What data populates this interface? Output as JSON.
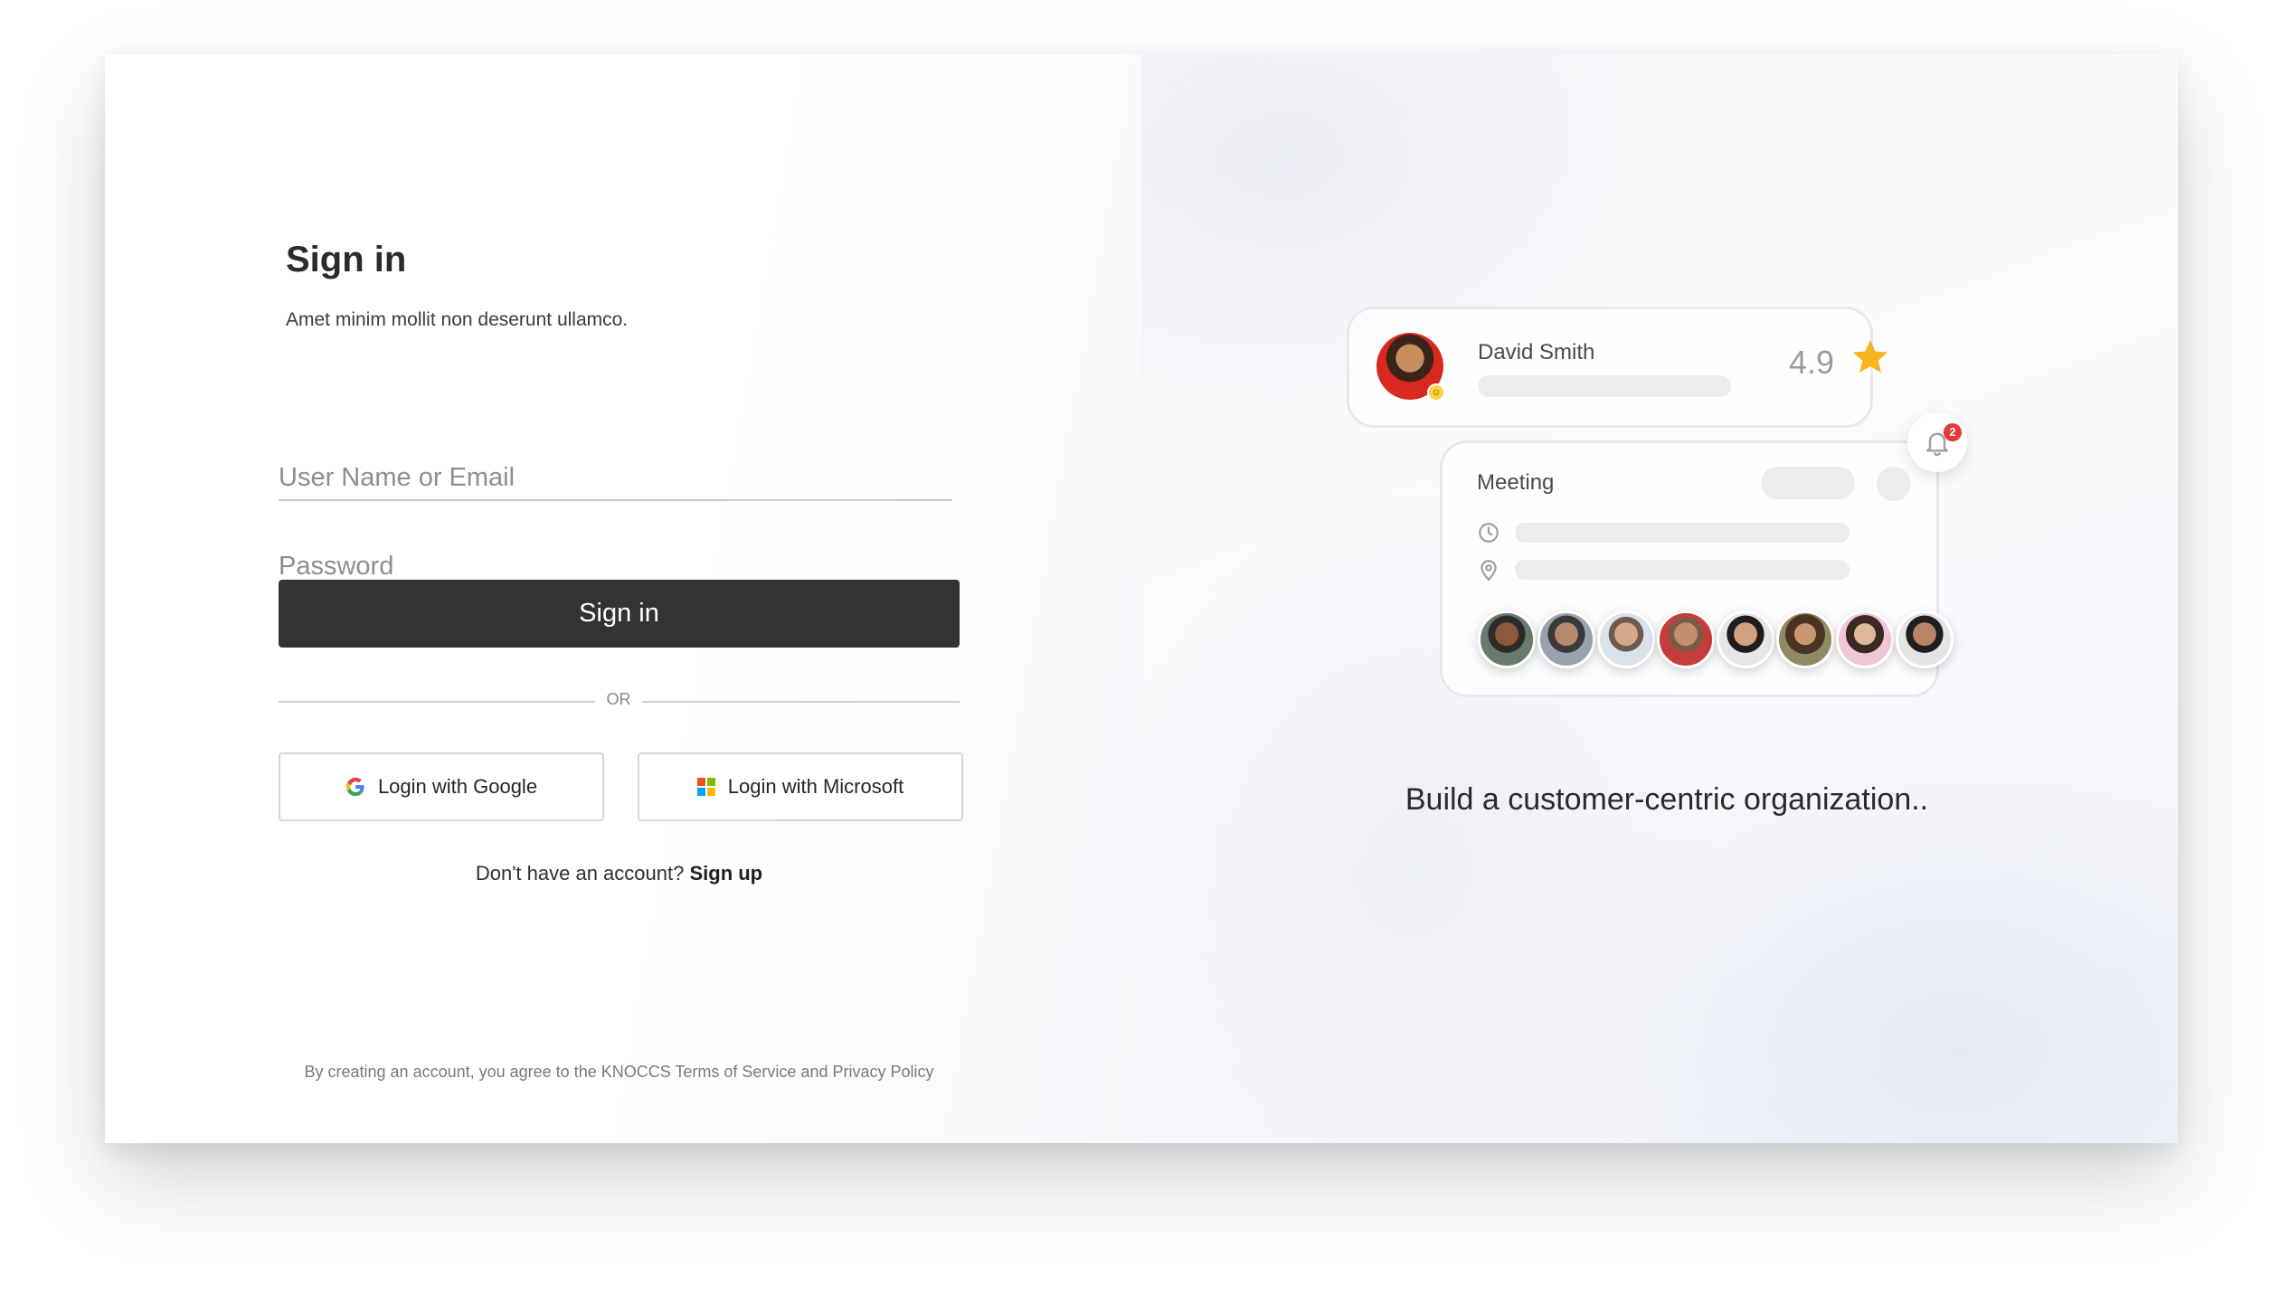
{
  "signin": {
    "title": "Sign in",
    "subtitle": "Amet minim mollit non deserunt ullamco.",
    "username_placeholder": "User Name or Email",
    "password_placeholder": "Password",
    "submit_label": "Sign in",
    "divider_text": "OR",
    "google_label": "Login with Google",
    "microsoft_label": "Login with Microsoft",
    "signup_prompt": "Don't have an account?",
    "signup_link": "Sign up",
    "footer": "By creating an account, you agree to the KNOCCS Terms of Service and Privacy Policy"
  },
  "showcase": {
    "profile": {
      "name": "David Smith",
      "rating": "4.9"
    },
    "meeting": {
      "title": "Meeting"
    },
    "notifications": {
      "count": "2"
    },
    "tagline": "Build a customer-centric organization.."
  },
  "colors": {
    "primary_button": "#333333",
    "star": "#f6b51e",
    "badge": "#e53935"
  },
  "icons": [
    "google-icon",
    "microsoft-icon",
    "star-icon",
    "bell-icon",
    "clock-icon",
    "location-pin-icon"
  ]
}
